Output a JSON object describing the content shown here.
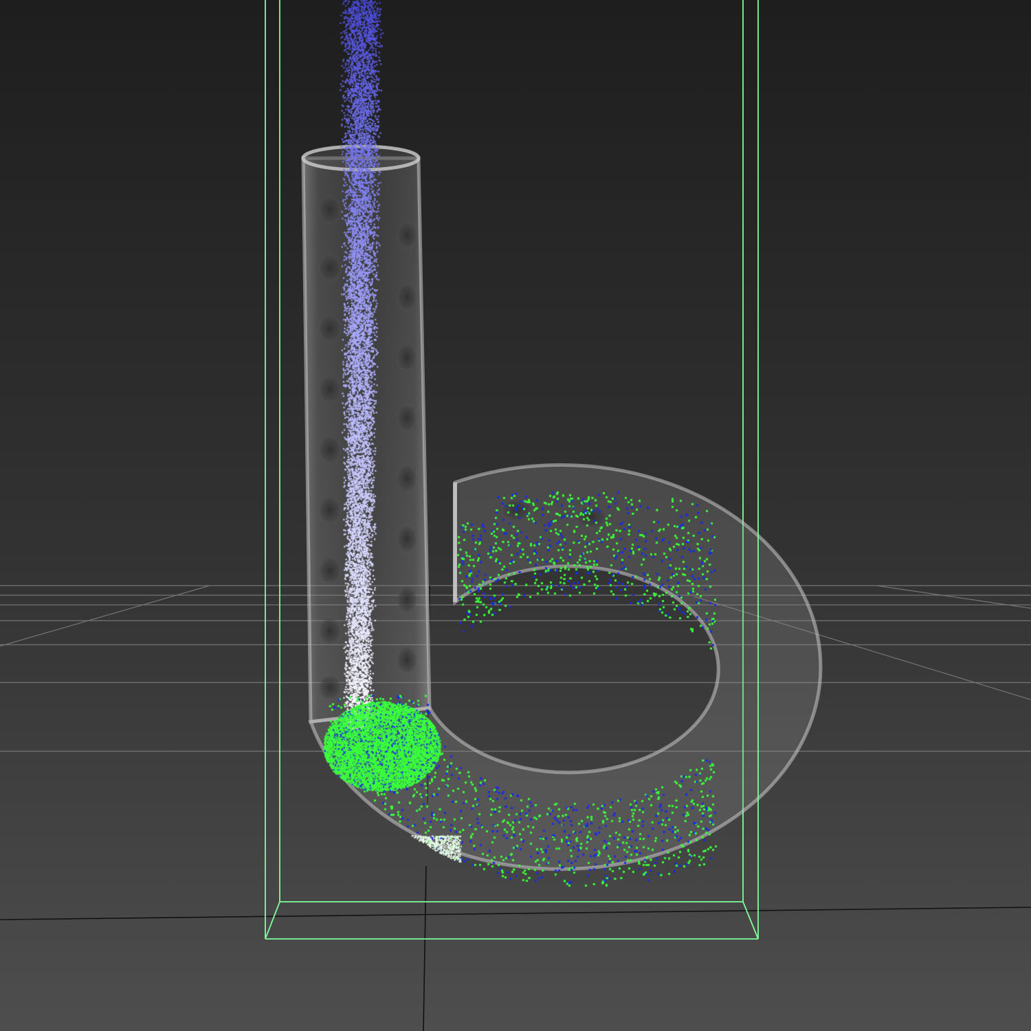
{
  "viewport": {
    "view_type": "3d-perspective",
    "background_top": "#1e1e1e",
    "background_bottom": "#4e4e4e",
    "grid_color": "#8a8a8a",
    "bounding_box_color": "#7dff9a"
  },
  "scene": {
    "object": "letter-b-tube",
    "material": "transparent-glass",
    "glass_tint": "#9a9a9a",
    "particles": {
      "emitter_color_top": "#4b4bdc",
      "emitter_color_mid": "#a8a8ff",
      "emitter_color_bottom": "#ffffff",
      "fluid_color_primary": "#3cff3c",
      "fluid_color_secondary": "#1e2ee6"
    }
  }
}
